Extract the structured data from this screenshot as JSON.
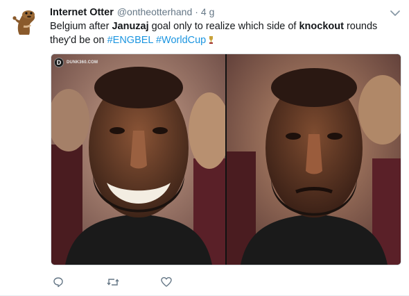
{
  "tweet": {
    "display_name": "Internet Otter",
    "handle": "@ontheotterhand",
    "separator": "·",
    "time": "4 g",
    "text_parts": {
      "p1": "Belgium after ",
      "bold1": "Januzaj",
      "p2": " goal only to realize which side of ",
      "bold2": "knockout",
      "p3": " rounds they'd be on ",
      "hashtag1": "#ENGBEL",
      "hashtag2": "#WorldCup"
    },
    "media": {
      "watermark_logo": "D",
      "watermark_text": "DUNK360.COM"
    }
  },
  "icons": {
    "avatar": "otter-avatar-icon",
    "caret": "chevron-down-icon",
    "trophy": "trophy-emoji-icon",
    "reply": "reply-icon",
    "retweet": "retweet-icon",
    "like": "heart-icon"
  },
  "colors": {
    "link": "#1b95e0",
    "secondary_text": "#657786",
    "primary_text": "#14171a"
  }
}
